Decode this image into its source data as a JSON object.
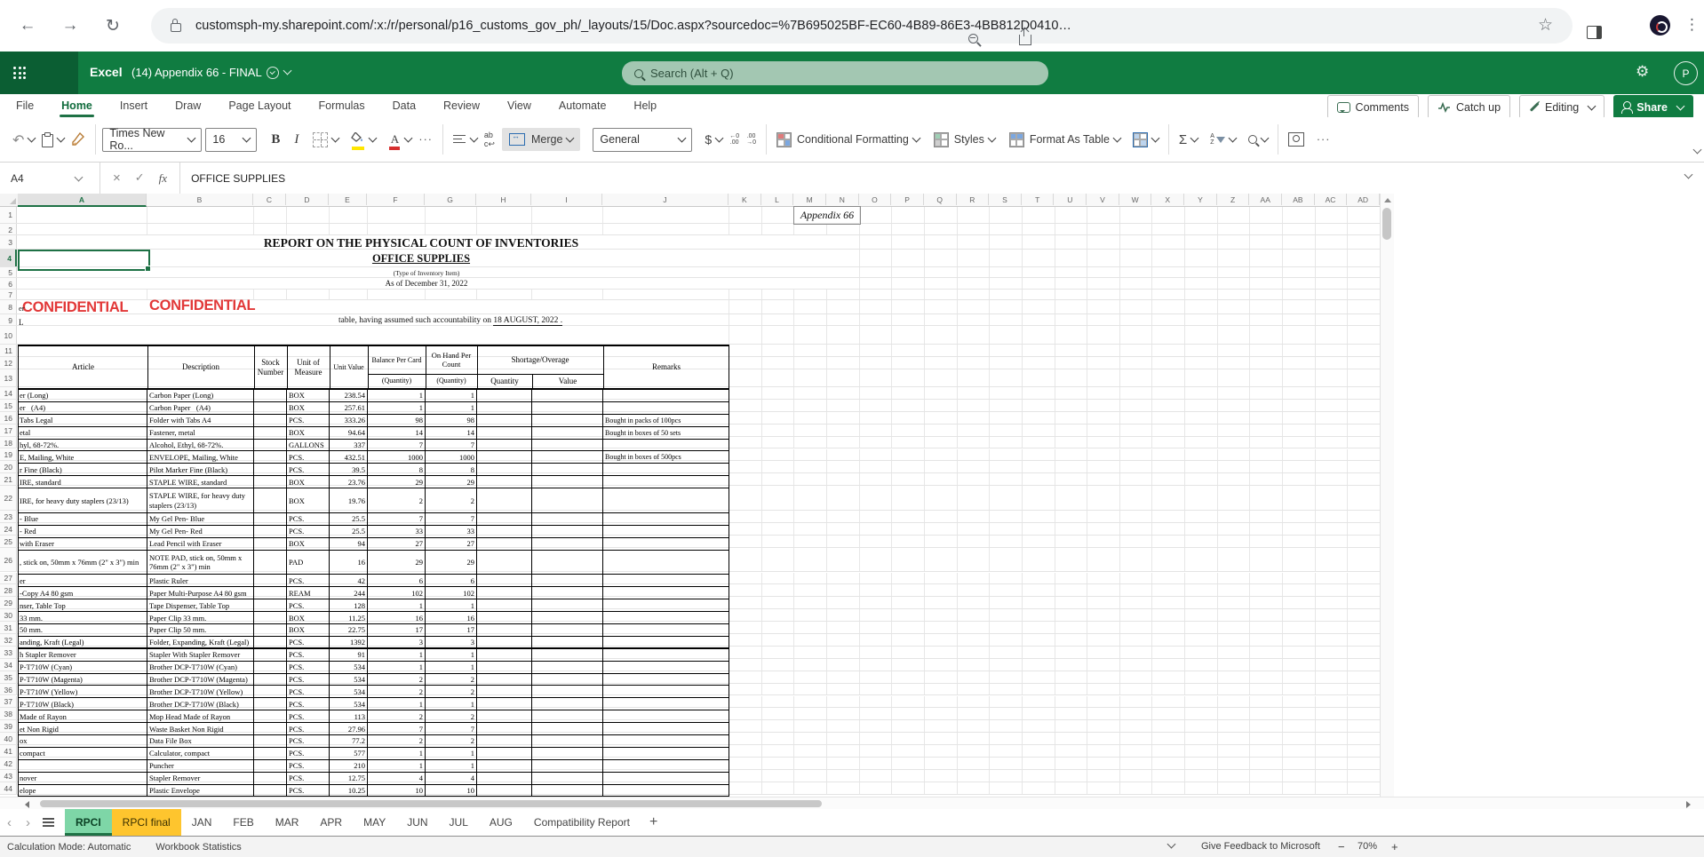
{
  "colors": {
    "excel_green": "#107C41",
    "excel_green_dark": "#0B5E33",
    "selection_green": "#1E7145",
    "confidential_red": "#E23838",
    "tab_active_bg": "#7ED6A7",
    "tab_highlight_bg": "#FEC52E"
  },
  "browser": {
    "url": "customsph-my.sharepoint.com/:x:/r/personal/p16_customs_gov_ph/_layouts/15/Doc.aspx?sourcedoc=%7B695025BF-EC60-4B89-86E3-4BB812D0410…"
  },
  "header": {
    "app_name": "Excel",
    "doc_title": "(14) Appendix 66 - FINAL",
    "search_placeholder": "Search (Alt + Q)",
    "avatar_initial": "P"
  },
  "menu": {
    "items": [
      "File",
      "Home",
      "Insert",
      "Draw",
      "Page Layout",
      "Formulas",
      "Data",
      "Review",
      "View",
      "Automate",
      "Help"
    ],
    "active_item": "Home",
    "comments_label": "Comments",
    "catchup_label": "Catch up",
    "editing_label": "Editing",
    "share_label": "Share"
  },
  "ribbon": {
    "undo_glyph": "↶",
    "font_name": "Times New Ro...",
    "font_size": "16",
    "bold_glyph": "B",
    "italic_glyph": "I",
    "merge_label": "Merge",
    "number_format": "General",
    "currency_glyph": "$",
    "decrease_decimal_glyph": "←0 .00",
    "increase_decimal_glyph": ".00 →0",
    "conditional_formatting_label": "Conditional Formatting",
    "styles_label": "Styles",
    "format_as_table_label": "Format As Table",
    "sigma_glyph": "Σ",
    "sort_glyph": "A Z",
    "ellipsis_glyph": "···"
  },
  "formula_bar": {
    "cell_ref": "A4",
    "cancel_glyph": "×",
    "enter_glyph": "✓",
    "fx_label": "fx",
    "formula": "OFFICE SUPPLIES"
  },
  "sheet": {
    "column_letters": [
      "A",
      "B",
      "C",
      "D",
      "E",
      "F",
      "G",
      "H",
      "I",
      "J",
      "K",
      "L",
      "M",
      "N",
      "O",
      "P",
      "Q",
      "R",
      "S",
      "T",
      "U",
      "V",
      "W",
      "X",
      "Y",
      "Z",
      "AA",
      "AB",
      "AC",
      "AD"
    ],
    "row_count": 44,
    "appendix_label": "Appendix 66",
    "title": "REPORT ON THE PHYSICAL COUNT OF INVENTORIES",
    "subtitle": "OFFICE SUPPLIES",
    "type_note": "(Type of Inventory Item)",
    "as_of": "As of December 31, 2022",
    "confidential_label": "CONFIDENTIAL",
    "row8_fragment": "er",
    "row9_fragment": "L",
    "accountability_text": "table, having assumed such accountability on ",
    "accountability_date": "18 AUGUST, 2022",
    "accountability_tail": " .",
    "table": {
      "headers": {
        "article": "Article",
        "description": "Description",
        "stock_number": "Stock Number",
        "unit_of_measure": "Unit of Measure",
        "unit_value": "Unit Value",
        "balance_per_card": "Balance Per Card",
        "on_hand_per_count": "On Hand Per Count",
        "shortage_overage": "Shortage/Overage",
        "quantity_sub": "(Quantity)",
        "quantity": "Quantity",
        "value": "Value",
        "remarks": "Remarks"
      },
      "rows": [
        {
          "n": 14,
          "article": "er (Long)",
          "description": "Carbon Paper (Long)",
          "unit": "BOX",
          "unit_value": "238.54",
          "balance": "1",
          "on_hand": "1",
          "remarks": ""
        },
        {
          "n": 15,
          "article": "er   (A4)",
          "description": "Carbon Paper   (A4)",
          "unit": "BOX",
          "unit_value": "257.61",
          "balance": "1",
          "on_hand": "1",
          "remarks": ""
        },
        {
          "n": 16,
          "article": "Tabs Legal",
          "description": "Folder with Tabs A4",
          "unit": "PCS.",
          "unit_value": "333.26",
          "balance": "98",
          "on_hand": "98",
          "remarks": "Bought in packs of 100pcs"
        },
        {
          "n": 17,
          "article": "etal",
          "description": "Fastener, metal",
          "unit": "BOX",
          "unit_value": "94.64",
          "balance": "14",
          "on_hand": "14",
          "remarks": "Bought in boxes of 50 sets"
        },
        {
          "n": 18,
          "article": "hyl, 68-72%.",
          "description": "Alcohol, Ethyl, 68-72%.",
          "unit": "GALLONS",
          "unit_value": "337",
          "balance": "7",
          "on_hand": "7",
          "remarks": ""
        },
        {
          "n": 19,
          "article": "E, Mailing, White",
          "description": "ENVELOPE, Mailing, White",
          "unit": "PCS.",
          "unit_value": "432.51",
          "balance": "1000",
          "on_hand": "1000",
          "remarks": "Bought in boxes of 500pcs"
        },
        {
          "n": 20,
          "article": "r Fine (Black)",
          "description": "Pilot Marker Fine (Black)",
          "unit": "PCS.",
          "unit_value": "39.5",
          "balance": "8",
          "on_hand": "8",
          "remarks": ""
        },
        {
          "n": 21,
          "article": "IRE, standard",
          "description": "STAPLE WIRE, standard",
          "unit": "BOX",
          "unit_value": "23.76",
          "balance": "29",
          "on_hand": "29",
          "remarks": ""
        },
        {
          "n": 22,
          "article": "IRE, for heavy duty staplers (23/13)",
          "description": "STAPLE WIRE, for heavy duty staplers (23/13)",
          "unit": "BOX",
          "unit_value": "19.76",
          "balance": "2",
          "on_hand": "2",
          "remarks": "",
          "tall": true
        },
        {
          "n": 23,
          "article": "- Blue",
          "description": "My Gel Pen- Blue",
          "unit": "PCS.",
          "unit_value": "25.5",
          "balance": "7",
          "on_hand": "7",
          "remarks": ""
        },
        {
          "n": 24,
          "article": "- Red",
          "description": "My Gel Pen- Red",
          "unit": "PCS.",
          "unit_value": "25.5",
          "balance": "33",
          "on_hand": "33",
          "remarks": ""
        },
        {
          "n": 25,
          "article": "with Eraser",
          "description": "Lead Pencil with Eraser",
          "unit": "BOX",
          "unit_value": "94",
          "balance": "27",
          "on_hand": "27",
          "remarks": ""
        },
        {
          "n": 26,
          "article": ", stick on, 50mm x 76mm (2\" x 3\") min",
          "description": "NOTE PAD, stick on, 50mm x 76mm (2\" x 3\") min",
          "unit": "PAD",
          "unit_value": "16",
          "balance": "29",
          "on_hand": "29",
          "remarks": "",
          "tall": true
        },
        {
          "n": 27,
          "article": "er",
          "description": "Plastic Ruler",
          "unit": "PCS.",
          "unit_value": "42",
          "balance": "6",
          "on_hand": "6",
          "remarks": ""
        },
        {
          "n": 28,
          "article": "-Copy A4 80 gsm",
          "description": "Paper Multi-Purpose A4 80 gsm",
          "unit": "REAM",
          "unit_value": "244",
          "balance": "102",
          "on_hand": "102",
          "remarks": ""
        },
        {
          "n": 29,
          "article": "nser, Table Top",
          "description": "Tape Dispenser, Table Top",
          "unit": "PCS.",
          "unit_value": "128",
          "balance": "1",
          "on_hand": "1",
          "remarks": ""
        },
        {
          "n": 30,
          "article": "33 mm.",
          "description": "Paper Clip 33 mm.",
          "unit": "BOX",
          "unit_value": "11.25",
          "balance": "16",
          "on_hand": "16",
          "remarks": ""
        },
        {
          "n": 31,
          "article": "50 mm.",
          "description": "Paper Clip 50 mm.",
          "unit": "BOX",
          "unit_value": "22.75",
          "balance": "17",
          "on_hand": "17",
          "remarks": ""
        },
        {
          "n": 32,
          "article": "anding, Kraft (Legal)",
          "description": "Folder, Expanding, Kraft (Legal)",
          "unit": "PCS.",
          "unit_value": "1392",
          "balance": "3",
          "on_hand": "3",
          "remarks": "",
          "thick_bottom": true
        },
        {
          "n": 33,
          "article": "h Stapler Remover",
          "description": "Stapler With Stapler Remover",
          "unit": "PCS.",
          "unit_value": "91",
          "balance": "1",
          "on_hand": "1",
          "remarks": ""
        },
        {
          "n": 34,
          "article": "P-T710W (Cyan)",
          "description": "Brother DCP-T710W (Cyan)",
          "unit": "PCS.",
          "unit_value": "534",
          "balance": "1",
          "on_hand": "1",
          "remarks": ""
        },
        {
          "n": 35,
          "article": "P-T710W (Magenta)",
          "description": "Brother DCP-T710W (Magenta)",
          "unit": "PCS.",
          "unit_value": "534",
          "balance": "2",
          "on_hand": "2",
          "remarks": ""
        },
        {
          "n": 36,
          "article": "P-T710W (Yellow)",
          "description": "Brother DCP-T710W (Yellow)",
          "unit": "PCS.",
          "unit_value": "534",
          "balance": "2",
          "on_hand": "2",
          "remarks": ""
        },
        {
          "n": 37,
          "article": "P-T710W (Black)",
          "description": "Brother DCP-T710W (Black)",
          "unit": "PCS.",
          "unit_value": "534",
          "balance": "1",
          "on_hand": "1",
          "remarks": ""
        },
        {
          "n": 38,
          "article": "Made of Rayon",
          "description": "Mop Head Made of Rayon",
          "unit": "PCS.",
          "unit_value": "113",
          "balance": "2",
          "on_hand": "2",
          "remarks": ""
        },
        {
          "n": 39,
          "article": "et Non Rigid",
          "description": "Waste Basket Non Rigid",
          "unit": "PCS.",
          "unit_value": "27.96",
          "balance": "7",
          "on_hand": "7",
          "remarks": ""
        },
        {
          "n": 40,
          "article": "ox",
          "description": "Data File Box",
          "unit": "PCS.",
          "unit_value": "77.2",
          "balance": "2",
          "on_hand": "2",
          "remarks": ""
        },
        {
          "n": 41,
          "article": "compact",
          "description": "Calculator, compact",
          "unit": "PCS.",
          "unit_value": "577",
          "balance": "1",
          "on_hand": "1",
          "remarks": ""
        },
        {
          "n": 42,
          "article": "",
          "description": "Puncher",
          "unit": "PCS.",
          "unit_value": "210",
          "balance": "1",
          "on_hand": "1",
          "remarks": ""
        },
        {
          "n": 43,
          "article": "nover",
          "description": "Stapler Remover",
          "unit": "PCS.",
          "unit_value": "12.75",
          "balance": "4",
          "on_hand": "4",
          "remarks": ""
        },
        {
          "n": 44,
          "article": "elope",
          "description": "Plastic Envelope",
          "unit": "PCS.",
          "unit_value": "10.25",
          "balance": "10",
          "on_hand": "10",
          "remarks": ""
        }
      ]
    }
  },
  "sheet_tabs": {
    "tabs": [
      {
        "label": "RPCI",
        "state": "active"
      },
      {
        "label": "RPCI final",
        "state": "highlighted"
      },
      {
        "label": "JAN",
        "state": "normal"
      },
      {
        "label": "FEB",
        "state": "normal"
      },
      {
        "label": "MAR",
        "state": "normal"
      },
      {
        "label": "APR",
        "state": "normal"
      },
      {
        "label": "MAY",
        "state": "normal"
      },
      {
        "label": "JUN",
        "state": "normal"
      },
      {
        "label": "JUL",
        "state": "normal"
      },
      {
        "label": "AUG",
        "state": "normal"
      },
      {
        "label": "Compatibility Report",
        "state": "normal"
      }
    ],
    "add_glyph": "+",
    "prev_glyph": "‹",
    "next_glyph": "›"
  },
  "status_bar": {
    "calculation_mode": "Calculation Mode: Automatic",
    "workbook_statistics": "Workbook Statistics",
    "feedback": "Give Feedback to Microsoft",
    "zoom_out_glyph": "−",
    "zoom_level": "70%",
    "zoom_in_glyph": "+"
  }
}
